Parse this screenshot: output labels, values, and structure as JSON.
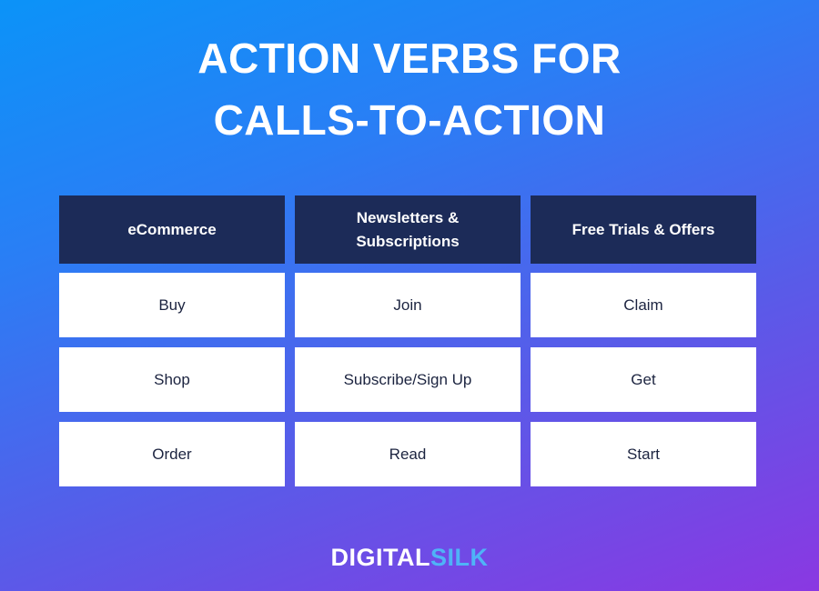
{
  "title": {
    "line1": "ACTION VERBS FOR",
    "line2": "CALLS-TO-ACTION"
  },
  "table": {
    "columns": [
      {
        "header": "eCommerce",
        "verbs": [
          "Buy",
          "Shop",
          "Order"
        ]
      },
      {
        "header": "Newsletters & Subscriptions",
        "verbs": [
          "Join",
          "Subscribe/Sign Up",
          "Read"
        ]
      },
      {
        "header": "Free Trials & Offers",
        "verbs": [
          "Claim",
          "Get",
          "Start"
        ]
      }
    ]
  },
  "logo": {
    "part1": "DIGITAL",
    "part2": "SILK"
  },
  "colors": {
    "header_bg": "#1c2b58",
    "gradient_start": "#0b93f8",
    "gradient_end": "#8a38e2",
    "logo_accent": "#4fb3f7"
  }
}
